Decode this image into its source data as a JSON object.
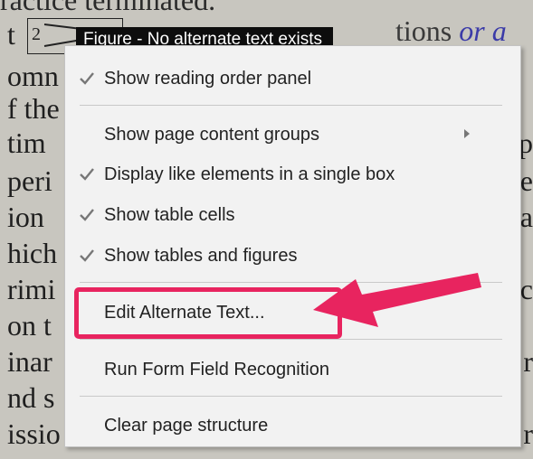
{
  "document": {
    "top_line": "ractice terminated.",
    "top_right_plain": "tions ",
    "top_right_emph": "or a",
    "left_fragments": [
      "t",
      "omn",
      "f the",
      "tim",
      "peri",
      "ion",
      "hich",
      "rimi",
      "on t",
      "inar",
      "nd s",
      "issio"
    ],
    "right_fragments": [
      "p",
      "e",
      "a",
      "c",
      "r",
      "r"
    ],
    "figure_number": "2"
  },
  "tooltip": {
    "text": "Figure - No alternate text exists"
  },
  "context_menu": {
    "items": [
      {
        "label": "Show reading order panel",
        "checked": true
      },
      {
        "label": "Show page content groups",
        "checked": false,
        "submenu": true
      },
      {
        "label": "Display like elements in a single box",
        "checked": true
      },
      {
        "label": "Show table cells",
        "checked": true
      },
      {
        "label": "Show tables and figures",
        "checked": true
      },
      {
        "label": "Edit Alternate Text...",
        "checked": false,
        "highlighted": true
      },
      {
        "label": "Run Form Field Recognition",
        "checked": false
      },
      {
        "label": "Clear page structure",
        "checked": false
      }
    ]
  },
  "annotation": {
    "color": "#e8245f"
  },
  "colors": {
    "menu_bg": "#f2f2f2",
    "tooltip_bg": "#0d0d0d",
    "page_bg": "#c8c6bf"
  }
}
